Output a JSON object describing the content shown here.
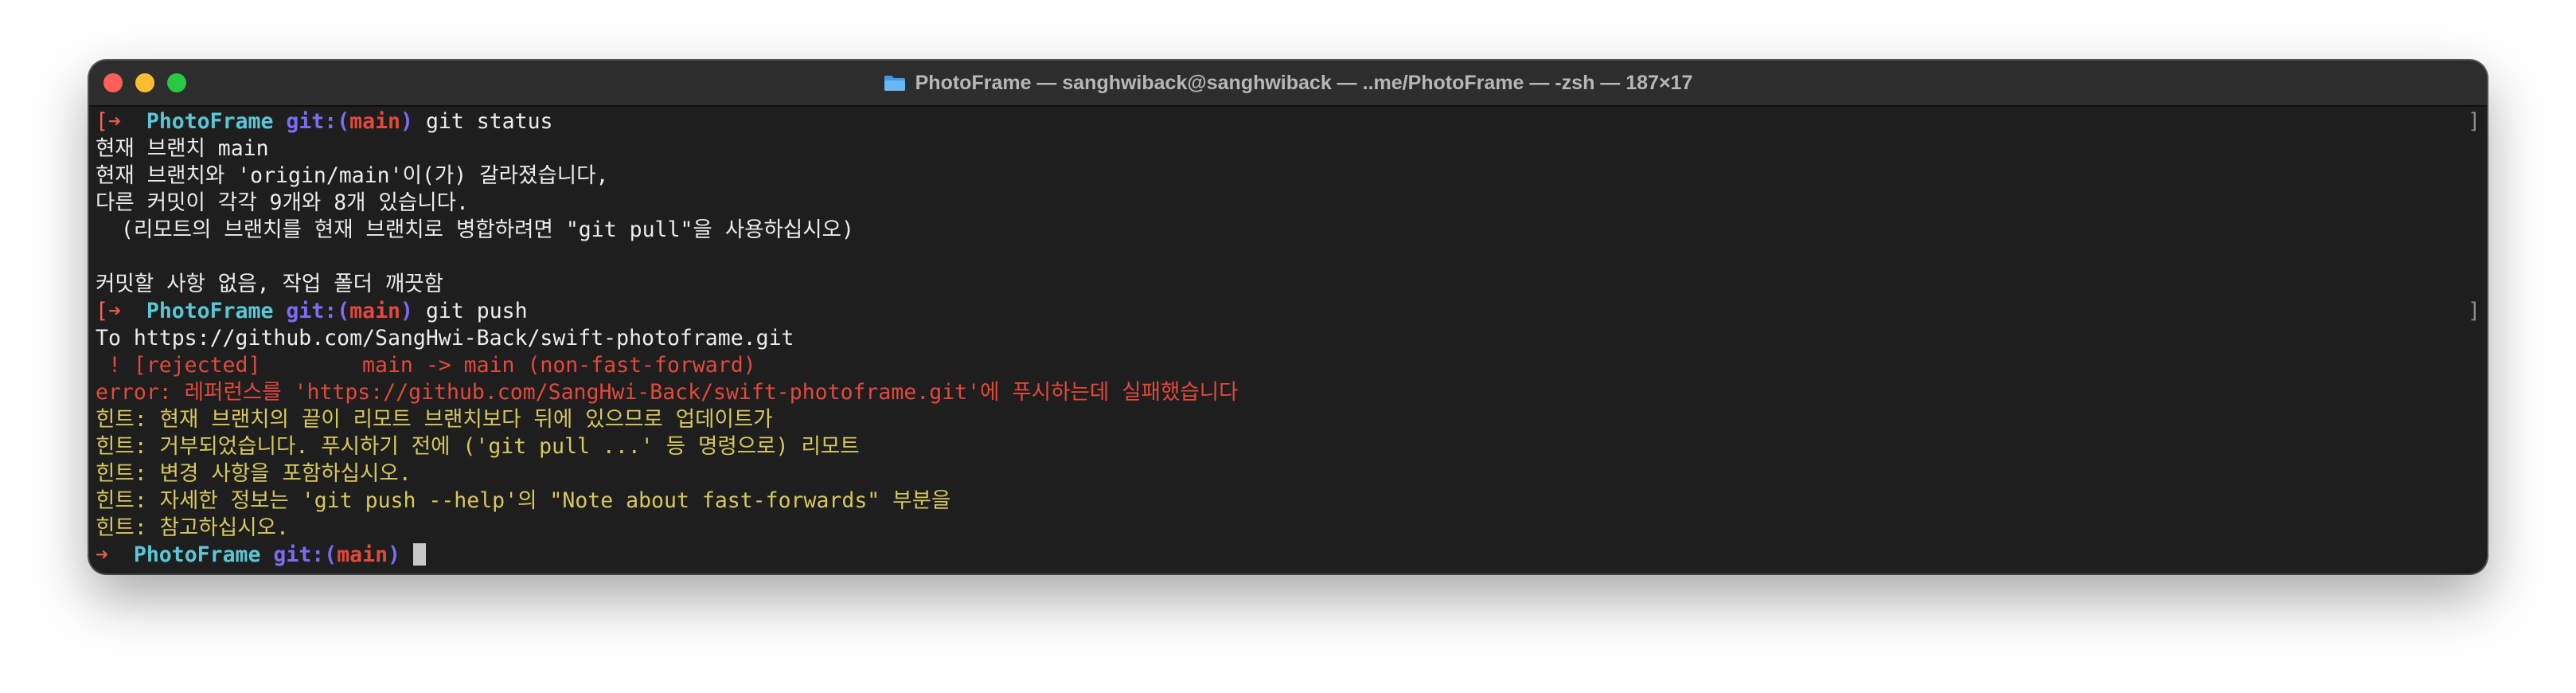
{
  "window": {
    "title": "PhotoFrame — sanghwiback@sanghwiback — ..me/PhotoFrame — -zsh — 187×17"
  },
  "prompt": {
    "arrow": "➜",
    "dir": "PhotoFrame",
    "git_label": "git:",
    "branch_open": "(",
    "branch": "main",
    "branch_close": ")"
  },
  "terminal": {
    "cmd1": "git status",
    "status_lines": [
      "현재 브랜치 main",
      "현재 브랜치와 'origin/main'이(가) 갈라졌습니다,",
      "다른 커밋이 각각 9개와 8개 있습니다.",
      "  (리모트의 브랜치를 현재 브랜치로 병합하려면 \"git pull\"을 사용하십시오)",
      "",
      "커밋할 사항 없음, 작업 폴더 깨끗함"
    ],
    "cmd2": "git push",
    "push_to": "To https://github.com/SangHwi-Back/swift-photoframe.git",
    "rejected": " ! [rejected]        main -> main (non-fast-forward)",
    "error": "error: 레퍼런스를 'https://github.com/SangHwi-Back/swift-photoframe.git'에 푸시하는데 실패했습니다",
    "hints": [
      "힌트: 현재 브랜치의 끝이 리모트 브랜치보다 뒤에 있으므로 업데이트가",
      "힌트: 거부되었습니다. 푸시하기 전에 ('git pull ...' 등 명령으로) 리모트",
      "힌트: 변경 사항을 포함하십시오.",
      "힌트: 자세한 정보는 'git push --help'의 \"Note about fast-forwards\" 부분을",
      "힌트: 참고하십시오."
    ]
  },
  "colors": {
    "background": "#1e1e1e",
    "prompt_arrow": "#e05a45",
    "directory": "#59c7d5",
    "git_label": "#7b6cf2",
    "branch": "#e2493b",
    "error": "#e2493b",
    "hint": "#d7c85a"
  },
  "icons": {
    "title": "folder-icon"
  }
}
